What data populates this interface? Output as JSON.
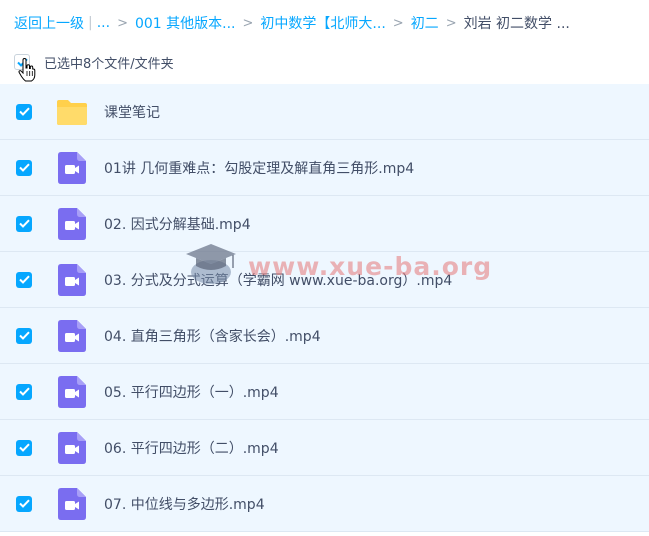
{
  "breadcrumb": {
    "back": "返回上一级",
    "ellipsis": "...",
    "items": [
      "001 其他版本...",
      "初中数学【北师大...",
      "初二"
    ],
    "current": "刘岩 初二数学 ..."
  },
  "selection": {
    "text": "已选中8个文件/文件夹"
  },
  "files": [
    {
      "name": "课堂笔记",
      "icon": "folder-icon"
    },
    {
      "name": "01讲 几何重难点：勾股定理及解直角三角形.mp4",
      "icon": "video-file-icon"
    },
    {
      "name": "02. 因式分解基础.mp4",
      "icon": "video-file-icon"
    },
    {
      "name": "03. 分式及分式运算（学霸网 www.xue-ba.org）.mp4",
      "icon": "video-file-icon"
    },
    {
      "name": "04. 直角三角形（含家长会）.mp4",
      "icon": "video-file-icon"
    },
    {
      "name": "05. 平行四边形（一）.mp4",
      "icon": "video-file-icon"
    },
    {
      "name": "06. 平行四边形（二）.mp4",
      "icon": "video-file-icon"
    },
    {
      "name": "07. 中位线与多边形.mp4",
      "icon": "video-file-icon"
    }
  ],
  "watermark": {
    "text": "www.xue-ba.org"
  },
  "colors": {
    "accent": "#06a7ff",
    "text": "#424e67",
    "row_bg": "#eef7ff",
    "folder": "#ffd04b",
    "video": "#7a6df0"
  }
}
